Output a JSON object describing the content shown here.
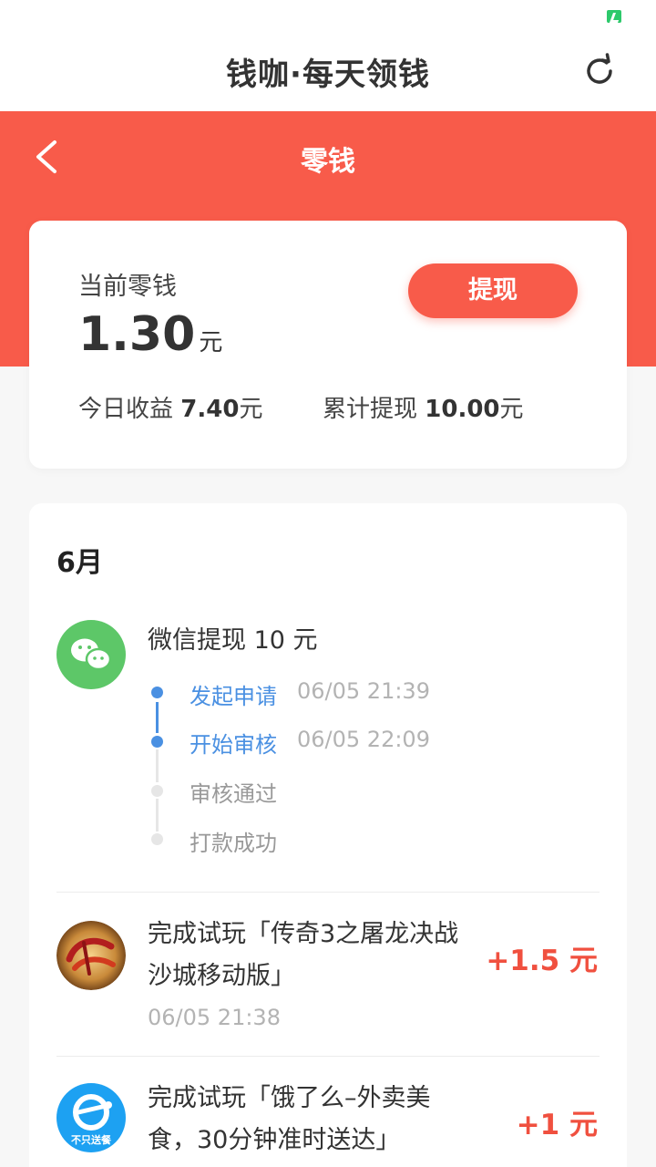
{
  "app": {
    "title": "钱咖·每天领钱"
  },
  "header": {
    "title": "零钱"
  },
  "balance": {
    "label": "当前零钱",
    "amount": "1.30",
    "unit": "元",
    "withdraw_label": "提现",
    "today_label": "今日收益",
    "today_value": "7.40",
    "total_label": "累计提现",
    "total_value": "10.00"
  },
  "history": {
    "month": "6月",
    "withdrawal": {
      "title": "微信提现 10 元",
      "steps": [
        {
          "label": "发起申请",
          "time": "06/05 21:39",
          "done": true
        },
        {
          "label": "开始审核",
          "time": "06/05 22:09",
          "done": true
        },
        {
          "label": "审核通过",
          "time": "",
          "done": false
        },
        {
          "label": "打款成功",
          "time": "",
          "done": false
        }
      ]
    },
    "items": [
      {
        "title_line1": "完成试玩「传奇3之屠龙决战",
        "title_line2": "沙城移动版」",
        "time": "06/05 21:38",
        "reward": "+1.5 元",
        "icon": "game-chuanqi-icon"
      },
      {
        "title_line1": "完成试玩「饿了么–外卖美",
        "title_line2": "食，30分钟准时送达」",
        "time": "",
        "reward": "+1 元",
        "icon": "eleme-icon",
        "icon_text": "不只送餐"
      }
    ]
  },
  "colors": {
    "accent": "#f85b4a",
    "wechat": "#5dc768",
    "timeline_active": "#4a90e2",
    "eleme": "#1da1f2"
  }
}
